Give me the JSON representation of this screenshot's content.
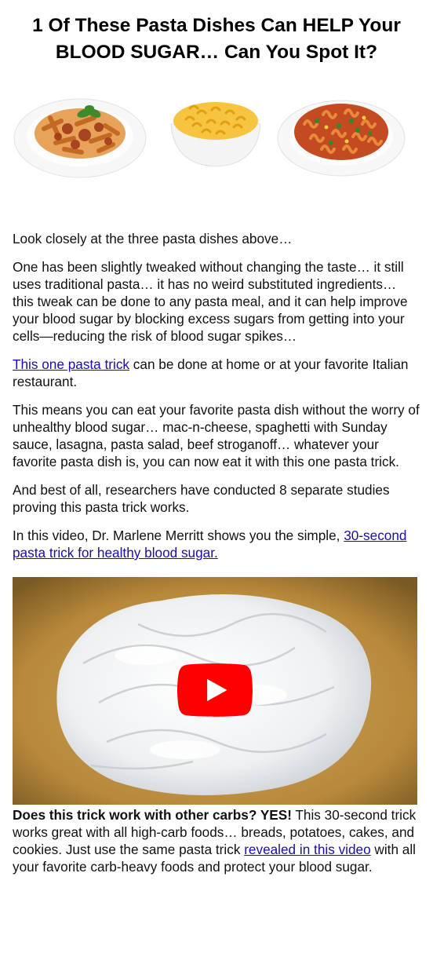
{
  "headline": "1 Of These Pasta Dishes Can HELP Your BLOOD SUGAR… Can You Spot It?",
  "images": {
    "dish1": "penne-bolognese-plate",
    "dish2": "mac-n-cheese-bowl",
    "dish3": "fusilli-vegetable-plate",
    "video_thumb": "white-rice-noodles-bowl",
    "play_icon": "youtube-play-icon"
  },
  "paragraphs": {
    "p1": "Look closely at the three pasta dishes above…",
    "p2": "One has been slightly tweaked without changing the taste… it still uses traditional pasta… it has no weird substituted ingredients… this tweak can be done to any pasta meal, and it can help improve your blood sugar by blocking excess sugars from getting into your cells—reducing the risk of blood sugar spikes…",
    "p3_link": "This one pasta trick",
    "p3_rest": " can be done at home or at your favorite Italian restaurant.",
    "p4": "This means you can eat your favorite pasta dish without the worry of unhealthy blood sugar… mac-n-cheese, spaghetti with Sunday sauce, lasagna, pasta salad, beef stroganoff… whatever your favorite pasta dish is, you can now eat it with this one pasta trick.",
    "p5": "And best of all, researchers have conducted 8 separate studies proving this pasta trick works.",
    "p6_pre": "In this video, Dr. Marlene Merritt shows you the simple, ",
    "p6_link": "30-second pasta trick for healthy blood sugar.",
    "p7_bold": "Does this trick work with other carbs? YES!",
    "p7_mid": " This 30-second trick works great with all high-carb foods… breads, potatoes, cakes, and cookies. Just use the same pasta trick ",
    "p7_link": "revealed in this video",
    "p7_end": " with all your favorite carb-heavy foods and protect your blood sugar."
  },
  "colors": {
    "link": "#1a0dab",
    "play_button": "#ff0000",
    "bowl": "#b8893b"
  }
}
